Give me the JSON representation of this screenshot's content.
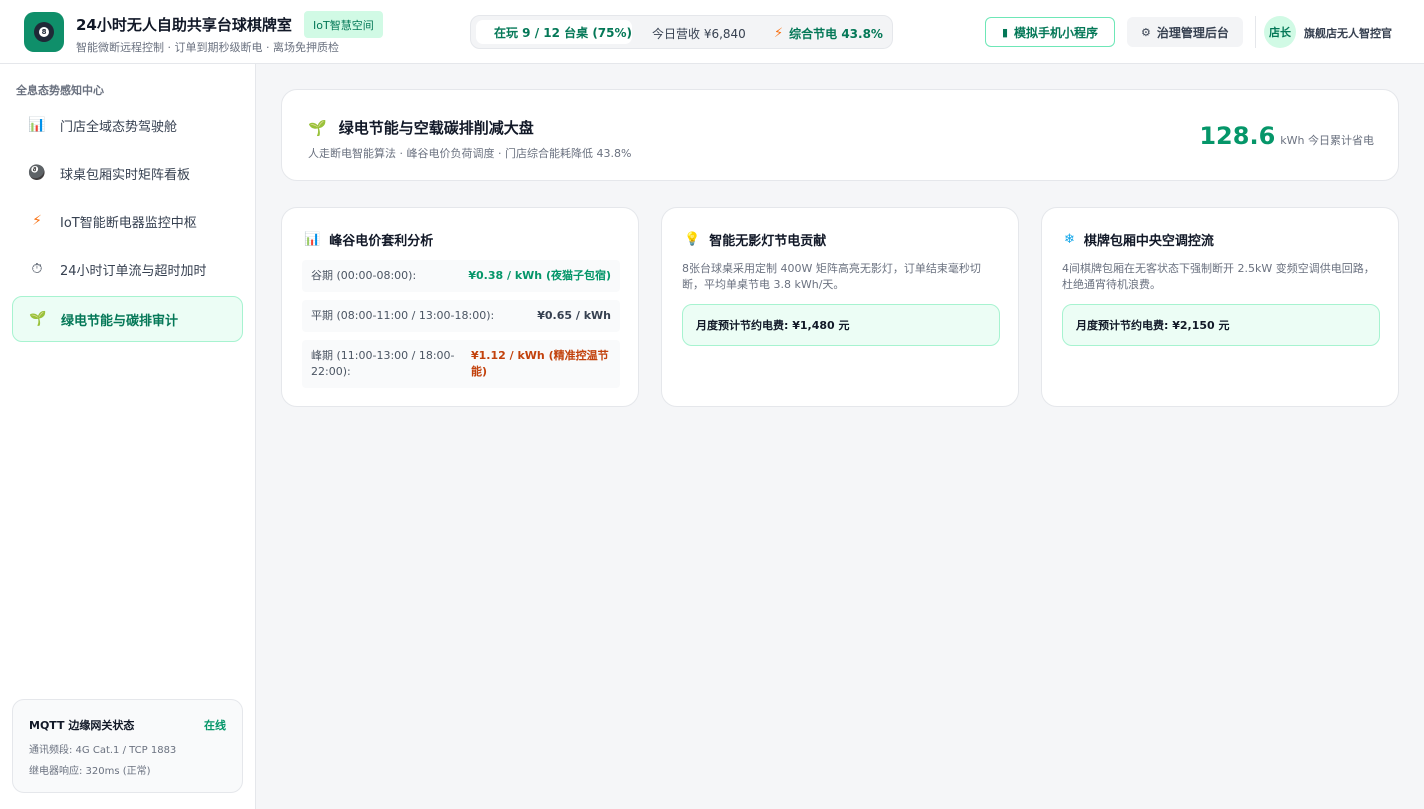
{
  "header": {
    "logo_glyph": "8",
    "title": "24小时无人自助共享台球棋牌室",
    "badge": "IoT智慧空间",
    "subtitle": "智能微断远程控制 · 订单到期秒级断电 · 离场免押质检",
    "status": {
      "playing": "在玩 9 / 12 台桌 (75%)",
      "revenue": "今日营收 ¥6,840",
      "energy": "综合节电 43.8%"
    },
    "mini_program_button": "模拟手机小程序",
    "admin_button": "治理管理后台",
    "avatar_text": "店长",
    "user_name": "旗舰店无人智控官"
  },
  "sidebar": {
    "heading": "全息态势感知中心",
    "items": [
      {
        "label": "门店全域态势驾驶舱",
        "icon": "bar-chart-icon"
      },
      {
        "label": "球桌包厢实时矩阵看板",
        "icon": "billiard-ball-icon"
      },
      {
        "label": "IoT智能断电器监控中枢",
        "icon": "lightning-icon"
      },
      {
        "label": "24小时订单流与超时加时",
        "icon": "stopwatch-icon"
      },
      {
        "label": "绿电节能与碳排审计",
        "icon": "seedling-icon"
      }
    ],
    "active_index": 4,
    "gateway": {
      "title": "MQTT 边缘网关状态",
      "status": "在线",
      "line1": "通讯频段: 4G Cat.1 / TCP 1883",
      "line2": "继电器响应: 320ms (正常)"
    }
  },
  "banner": {
    "title": "绿电节能与空载碳排削减大盘",
    "subtitle": "人走断电智能算法 · 峰谷电价负荷调度 · 门店综合能耗降低 43.8%",
    "metric_value": "128.6",
    "metric_unit": "kWh 今日累计省电"
  },
  "cards": {
    "tariff": {
      "title": "峰谷电价套利分析",
      "rows": [
        {
          "label": "谷期 (00:00-08:00):",
          "value": "¥0.38 / kWh (夜猫子包宿)"
        },
        {
          "label": "平期 (08:00-11:00 / 13:00-18:00):",
          "value": "¥0.65 / kWh"
        },
        {
          "label": "峰期 (11:00-13:00 / 18:00-22:00):",
          "value": "¥1.12 / kWh (精准控温节能)"
        }
      ]
    },
    "lighting": {
      "title": "智能无影灯节电贡献",
      "desc": "8张台球桌采用定制 400W 矩阵高亮无影灯，订单结束毫秒切断，平均单桌节电 3.8 kWh/天。",
      "saving": "月度预计节约电费: ¥1,480 元"
    },
    "aircon": {
      "title": "棋牌包厢中央空调控流",
      "desc": "4间棋牌包厢在无客状态下强制断开 2.5kW 变频空调供电回路，杜绝通宵待机浪费。",
      "saving": "月度预计节约电费: ¥2,150 元"
    }
  },
  "colors": {
    "brand": "#0f8f6a",
    "accent_green": "#059669",
    "peak_orange": "#c2410c"
  }
}
